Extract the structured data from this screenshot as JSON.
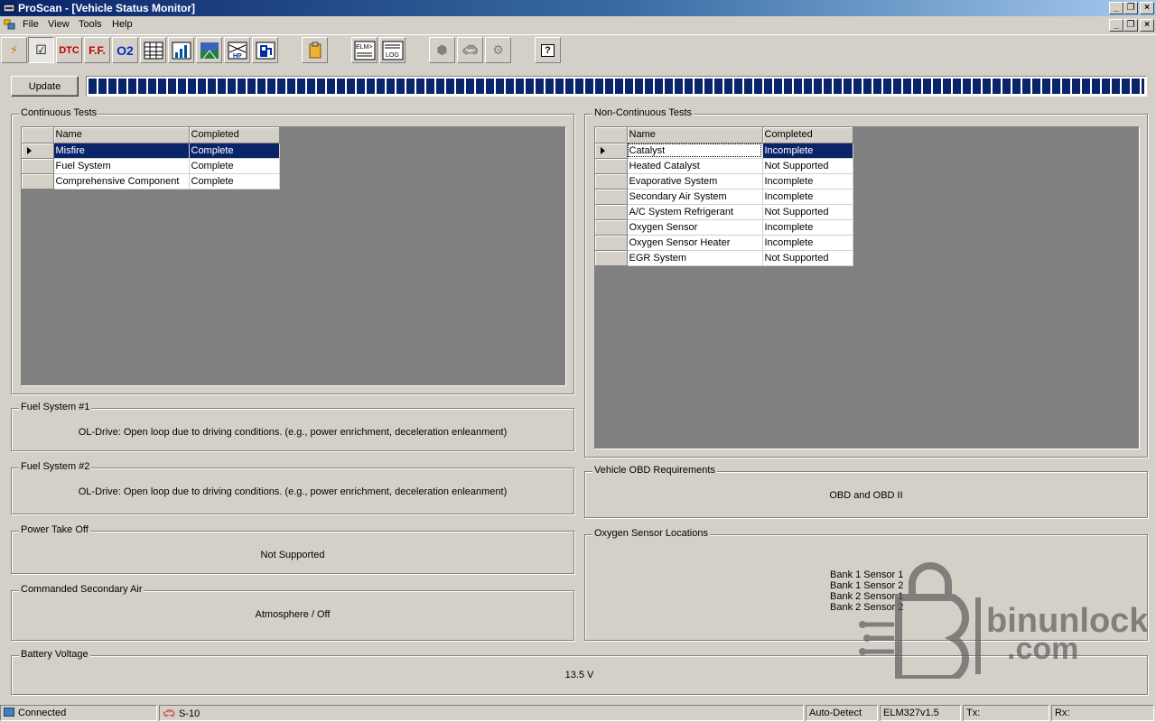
{
  "window": {
    "title": "ProScan - [Vehicle Status Monitor]"
  },
  "menu": {
    "items": [
      "File",
      "View",
      "Tools",
      "Help"
    ]
  },
  "toolbar": {
    "buttons": [
      {
        "name": "connect-icon"
      },
      {
        "name": "status-monitor-icon"
      },
      {
        "name": "dtc-icon",
        "label": "DTC"
      },
      {
        "name": "freeze-frame-icon",
        "label": "F.F."
      },
      {
        "name": "o2-sensor-icon",
        "label": "O2"
      },
      {
        "name": "data-grid-icon"
      },
      {
        "name": "graph-icon"
      },
      {
        "name": "dashboard-icon"
      },
      {
        "name": "horsepower-icon",
        "label": "HP"
      },
      {
        "name": "fuel-icon"
      },
      {
        "name": "report-icon"
      },
      {
        "name": "elm-terminal-icon",
        "label": "ELM>"
      },
      {
        "name": "log-icon",
        "label": "LOG"
      },
      {
        "name": "engine-icon"
      },
      {
        "name": "vehicle-icon"
      },
      {
        "name": "settings-icon"
      },
      {
        "name": "help-icon",
        "label": "?"
      }
    ]
  },
  "update_label": "Update",
  "progress_fraction": 1.0,
  "continuous": {
    "legend": "Continuous Tests",
    "headers": [
      "Name",
      "Completed"
    ],
    "rows": [
      {
        "name": "Misfire",
        "completed": "Complete"
      },
      {
        "name": "Fuel System",
        "completed": "Complete"
      },
      {
        "name": "Comprehensive Component",
        "completed": "Complete"
      }
    ]
  },
  "noncontinuous": {
    "legend": "Non-Continuous Tests",
    "headers": [
      "Name",
      "Completed"
    ],
    "rows": [
      {
        "name": "Catalyst",
        "completed": "Incomplete"
      },
      {
        "name": "Heated Catalyst",
        "completed": "Not Supported"
      },
      {
        "name": "Evaporative System",
        "completed": "Incomplete"
      },
      {
        "name": "Secondary Air System",
        "completed": "Incomplete"
      },
      {
        "name": "A/C System Refrigerant",
        "completed": "Not Supported"
      },
      {
        "name": "Oxygen Sensor",
        "completed": "Incomplete"
      },
      {
        "name": "Oxygen Sensor Heater",
        "completed": "Incomplete"
      },
      {
        "name": "EGR System",
        "completed": "Not Supported"
      }
    ]
  },
  "fuel1": {
    "legend": "Fuel System #1",
    "value": "OL-Drive: Open loop due to driving conditions. (e.g., power enrichment, deceleration enleanment)"
  },
  "fuel2": {
    "legend": "Fuel System #2",
    "value": "OL-Drive: Open loop due to driving conditions. (e.g., power enrichment, deceleration enleanment)"
  },
  "pto": {
    "legend": "Power Take Off",
    "value": "Not Supported"
  },
  "secair": {
    "legend": "Commanded Secondary Air",
    "value": "Atmosphere / Off"
  },
  "obd": {
    "legend": "Vehicle OBD Requirements",
    "value": "OBD and OBD II"
  },
  "o2loc": {
    "legend": "Oxygen Sensor Locations",
    "items": [
      "Bank 1 Sensor 1",
      "Bank 1 Sensor 2",
      "Bank 2 Sensor 1",
      "Bank 2 Sensor 2"
    ]
  },
  "battery": {
    "legend": "Battery Voltage",
    "value": "13.5 V"
  },
  "status": {
    "connection": "Connected",
    "vehicle": "S-10",
    "protocol": "Auto-Detect",
    "interface": "ELM327v1.5",
    "tx": "Tx:",
    "rx": "Rx:"
  },
  "watermark": {
    "text1": "binunlock",
    "text2": ".com"
  }
}
